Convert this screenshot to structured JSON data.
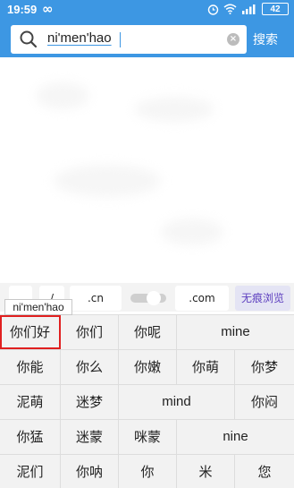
{
  "status_bar": {
    "time": "19:59",
    "infinity": "∞",
    "battery": "42",
    "icons": [
      "alarm-icon",
      "wifi-icon",
      "signal-icon",
      "battery-icon"
    ]
  },
  "search": {
    "query": "ni'men'hao",
    "button_label": "搜索"
  },
  "suggestion_bar": {
    "chip_slash": "/",
    "chip_cn": ".cn",
    "chip_com": ".com",
    "incognito": "无痕浏览"
  },
  "pinyin_popup": "ni'men'hao",
  "candidates": {
    "row1": [
      "你们好",
      "你们",
      "你呢",
      "mine"
    ],
    "row2": [
      "你能",
      "你么",
      "你嫩",
      "你萌",
      "你梦"
    ],
    "row3": [
      "泥萌",
      "迷梦",
      "mind",
      "你闷"
    ],
    "row4": [
      "你猛",
      "迷蒙",
      "咪蒙",
      "nine"
    ],
    "row5": [
      "泥们",
      "你呐",
      "你",
      "米",
      "您"
    ]
  },
  "colors": {
    "accent": "#3d97e3",
    "selected_outline": "#e02020",
    "incognito_text": "#5d3fbf"
  }
}
